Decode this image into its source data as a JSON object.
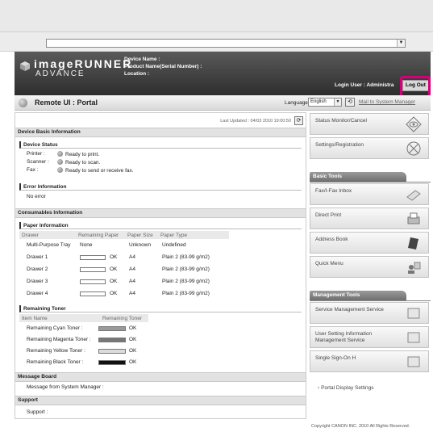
{
  "browser": {
    "address_dropdown": "▼"
  },
  "header": {
    "brand_line1": "imageRUNNER",
    "brand_line2": "ADVANCE",
    "device_name_label": "Device Name :",
    "product_name_label": "Product Name(Serial Number) :",
    "location_label": "Location :",
    "login_user": "Login User : Administra",
    "logout_label": "Log Out"
  },
  "portal_bar": {
    "title": "Remote UI : Portal",
    "language_label": "Language",
    "language_value": "English",
    "mail_link": "Mail to System Manager"
  },
  "main": {
    "last_updated": "Last Updated : 04/03 2010 19:00:50",
    "device_basic_info": "Device Basic Information",
    "device_status": {
      "heading": "Device Status",
      "rows": [
        {
          "label": "Printer :",
          "value": "Ready to print."
        },
        {
          "label": "Scanner :",
          "value": "Ready to scan."
        },
        {
          "label": "Fax :",
          "value": "Ready to send or receive fax."
        }
      ]
    },
    "error_info": {
      "heading": "Error Information",
      "value": "No error"
    },
    "consumables": "Consumables Information",
    "paper": {
      "heading": "Paper Information",
      "columns": [
        "Drawer",
        "Remaining Paper",
        "Paper Size",
        "Paper Type"
      ],
      "rows": [
        {
          "drawer": "Multi-Purpose Tray",
          "remaining": "None",
          "size": "Unknown",
          "type": "Undefined",
          "level": null
        },
        {
          "drawer": "Drawer 1",
          "remaining": "OK",
          "size": "A4",
          "type": "Plain 2 (83-99 g/m2)",
          "level": 0
        },
        {
          "drawer": "Drawer 2",
          "remaining": "OK",
          "size": "A4",
          "type": "Plain 2 (83-99 g/m2)",
          "level": 0
        },
        {
          "drawer": "Drawer 3",
          "remaining": "OK",
          "size": "A4",
          "type": "Plain 2 (83-99 g/m2)",
          "level": 0
        },
        {
          "drawer": "Drawer 4",
          "remaining": "OK",
          "size": "A4",
          "type": "Plain 2 (83-99 g/m2)",
          "level": 0
        }
      ]
    },
    "toner": {
      "heading": "Remaining Toner",
      "columns": [
        "Item Name",
        "Remaining Toner"
      ],
      "rows": [
        {
          "name": "Remaining Cyan Toner :",
          "value": "OK",
          "color": "#9a9a9a"
        },
        {
          "name": "Remaining Magenta Toner :",
          "value": "OK",
          "color": "#777777"
        },
        {
          "name": "Remaining Yellow Toner :",
          "value": "OK",
          "color": "#dcdcdc"
        },
        {
          "name": "Remaining Black Toner :",
          "value": "OK",
          "color": "#111111"
        }
      ]
    },
    "message_board": {
      "heading": "Message Board",
      "value": "Message from System Manager :"
    },
    "support": {
      "heading": "Support",
      "value": "Support :"
    }
  },
  "sidebar": {
    "top_buttons": [
      "Status Monitor/Cancel",
      "Settings/Registration"
    ],
    "basic_tools": {
      "heading": "Basic Tools",
      "items": [
        "Fax/I-Fax Inbox",
        "Direct Print",
        "Address Book",
        "Quick Menu"
      ]
    },
    "management_tools": {
      "heading": "Management Tools",
      "items": [
        "Service Management Service",
        "User Setting Information Management Service",
        "Single Sign-On H"
      ]
    },
    "portal_display_settings": "Portal Display Settings"
  },
  "footer": {
    "copyright": "Copyright CANON INC. 2010 All Rights Reserved."
  }
}
